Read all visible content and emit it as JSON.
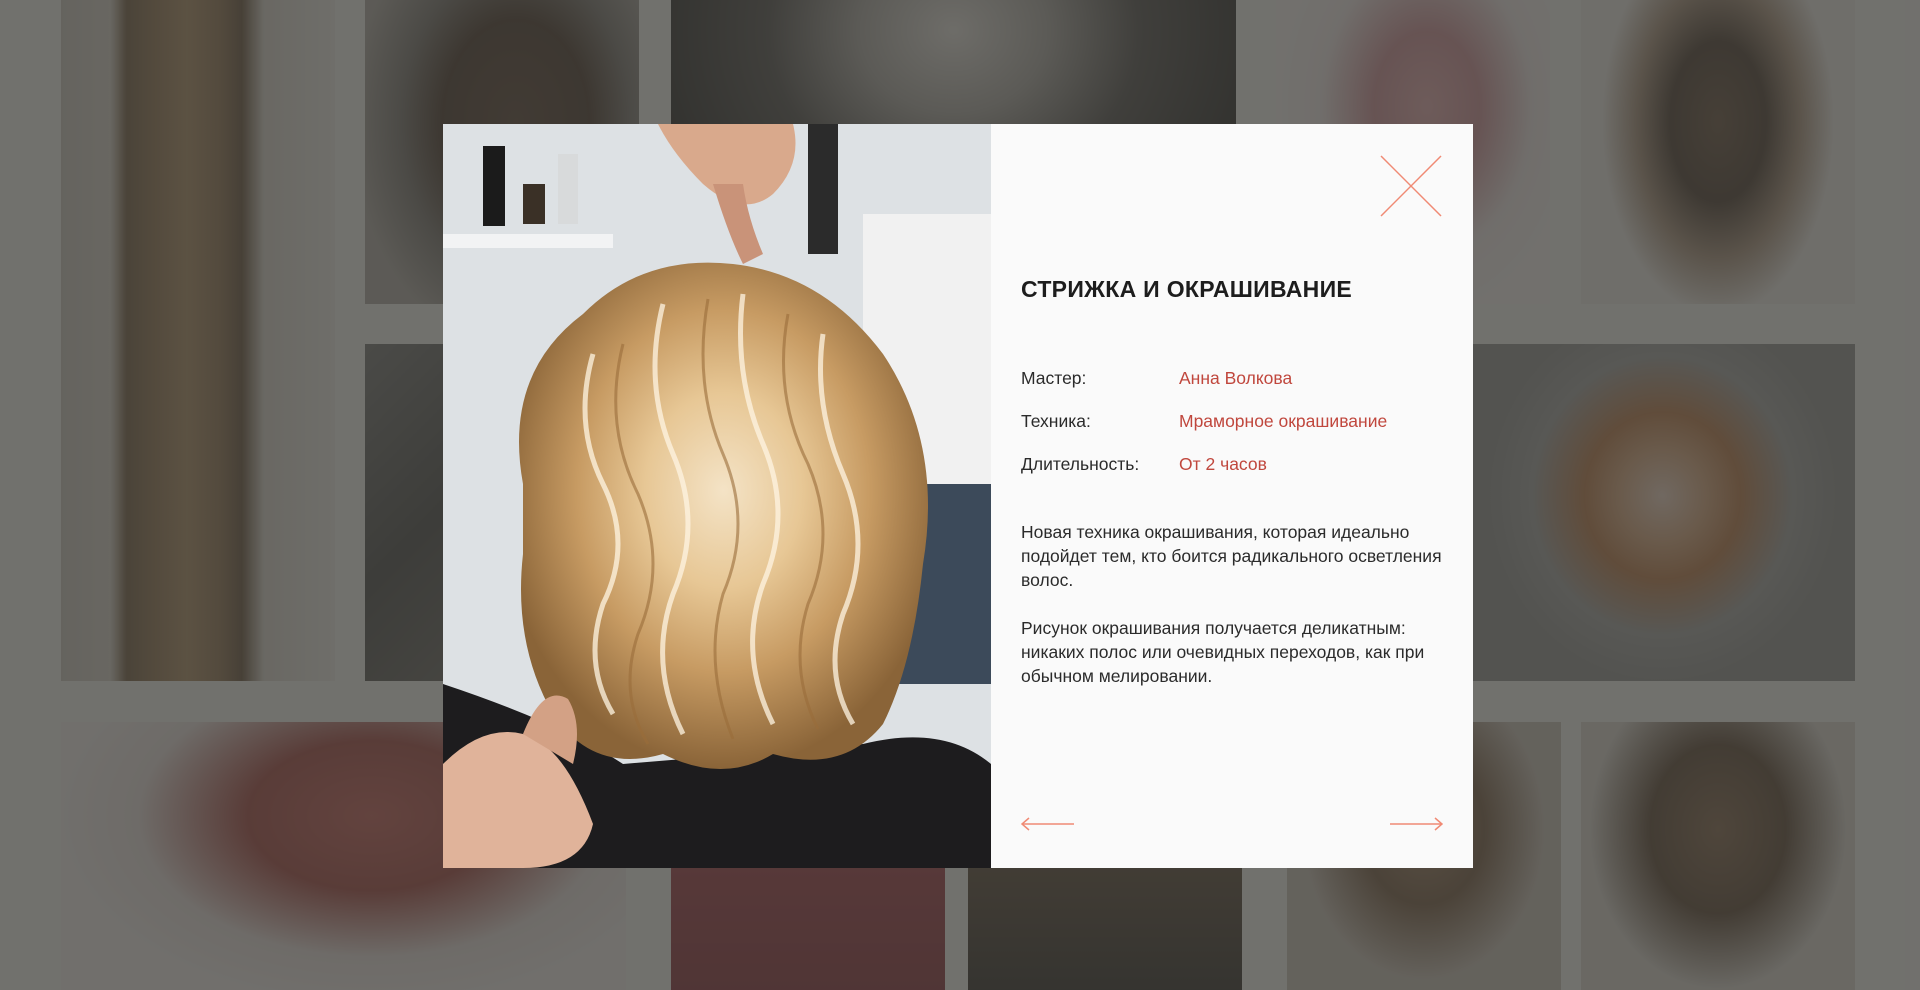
{
  "modal": {
    "title": "СТРИЖКА И ОКРАШИВАНИЕ",
    "details": [
      {
        "label": "Мастер:",
        "value": "Анна Волкова"
      },
      {
        "label": "Техника:",
        "value": "Мраморное окрашивание"
      },
      {
        "label": "Длительность:",
        "value": "От 2 часов"
      }
    ],
    "description": [
      "Новая техника окрашивания, которая идеально подойдет тем, кто боится радикального осветления волос.",
      "Рисунок окрашивания получается деликатным: никаких полос или очевидных переходов, как при обычном мелировании."
    ],
    "close_icon": "close-x-icon",
    "prev_icon": "arrow-left-icon",
    "next_icon": "arrow-right-icon"
  },
  "colors": {
    "accent": "#f08a74",
    "value_text": "#c0473d",
    "overlay": "rgba(62,62,58,0.72)",
    "modal_bg": "#fafafa"
  }
}
